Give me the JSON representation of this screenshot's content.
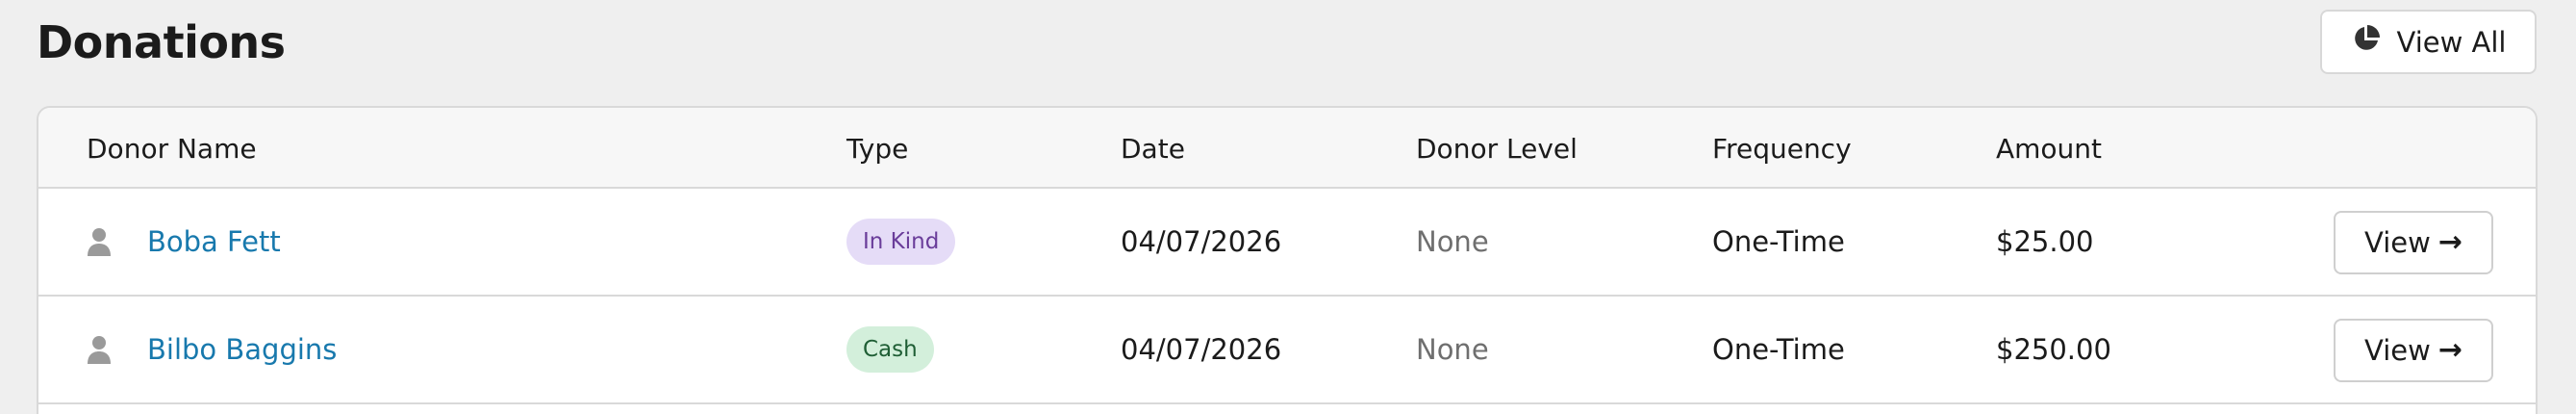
{
  "header": {
    "title": "Donations",
    "view_all": {
      "label": "View All",
      "icon": "pie-chart-icon"
    }
  },
  "table": {
    "columns": [
      "Donor Name",
      "Type",
      "Date",
      "Donor Level",
      "Frequency",
      "Amount"
    ],
    "rows": [
      {
        "donor_name": "Boba Fett",
        "type": "In Kind",
        "type_bg": "#e5dcf7",
        "type_color": "#6a3d9a",
        "date": "04/07/2026",
        "donor_level": "None",
        "frequency": "One-Time",
        "amount": "$25.00",
        "view_label": "View"
      },
      {
        "donor_name": "Bilbo Baggins",
        "type": "Cash",
        "type_bg": "#d3efdb",
        "type_color": "#1f5e35",
        "date": "04/07/2026",
        "donor_level": "None",
        "frequency": "One-Time",
        "amount": "$250.00",
        "view_label": "View"
      }
    ]
  },
  "colors": {
    "link": "#1879ad",
    "background": "#efefef",
    "muted_text": "#6f6f6f"
  }
}
